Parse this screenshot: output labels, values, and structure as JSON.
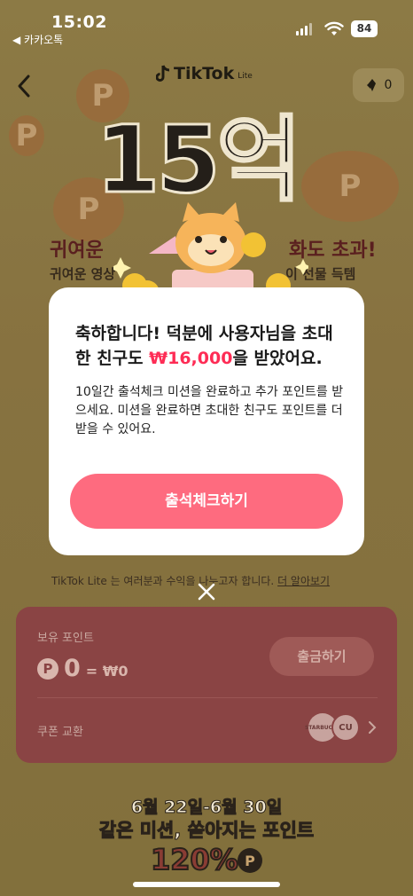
{
  "status": {
    "time": "15:02",
    "back_app": "◀ 카카오톡",
    "battery": "84"
  },
  "header": {
    "logo": "TikTok",
    "logo_suffix": "Lite",
    "points": "0"
  },
  "hero": {
    "big_text": "15억",
    "line1_left": "귀여운",
    "line1_right": "화도 초과!",
    "line2_left": "귀여운 영상",
    "line2_right": "이 선물 득템"
  },
  "modal": {
    "title_pre": "축하합니다! 덕분에 사용자님을 초대한 친구도 ",
    "amount": "₩16,000",
    "title_post": "을 받았어요.",
    "body": "10일간 출석체크 미션을 완료하고 추가 포인트를 받으세요. 미션을 완료하면 초대한 친구도 포인트를 더 받을 수 있어요.",
    "cta": "출석체크하기"
  },
  "notice": {
    "text": "TikTok Lite 는 여러분과 수익을 나누고자 합니다.",
    "link": "더 알아보기"
  },
  "card": {
    "label": "보유 포인트",
    "points": "0",
    "won": "= ₩0",
    "withdraw": "출금하기",
    "coupon": "쿠폰 교환",
    "brand_a": "STARBUCKS",
    "brand_b": "CU"
  },
  "promo": {
    "dates": "6월 22일-6월 30일",
    "line": "같은 미션, 쏟아지는 포인트",
    "percent": "120%"
  },
  "colors": {
    "accent": "#fe2c55",
    "cta": "#fe6b7f",
    "card": "#8a4444"
  }
}
